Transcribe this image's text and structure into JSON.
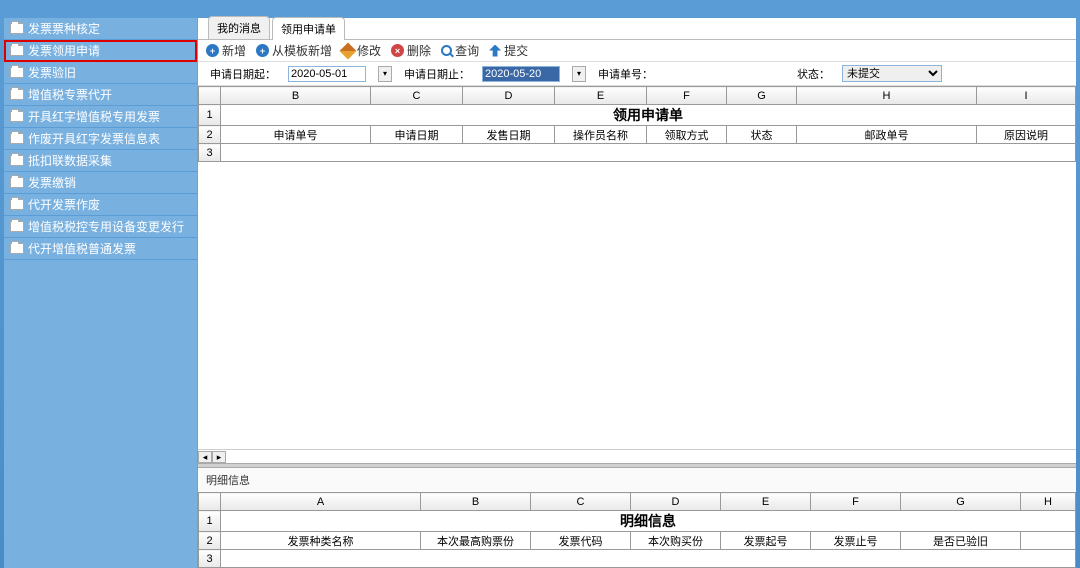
{
  "sidebar": {
    "items": [
      {
        "label": "发票票种核定"
      },
      {
        "label": "发票领用申请"
      },
      {
        "label": "发票验旧"
      },
      {
        "label": "增值税专票代开"
      },
      {
        "label": "开具红字增值税专用发票"
      },
      {
        "label": "作废开具红字发票信息表"
      },
      {
        "label": "抵扣联数据采集"
      },
      {
        "label": "发票缴销"
      },
      {
        "label": "代开发票作废"
      },
      {
        "label": "增值税税控专用设备变更发行"
      },
      {
        "label": "代开增值税普通发票"
      }
    ]
  },
  "tabs": [
    {
      "label": "我的消息"
    },
    {
      "label": "领用申请单"
    }
  ],
  "toolbar": {
    "new": "新增",
    "new_from_tpl": "从模板新增",
    "edit": "修改",
    "delete": "删除",
    "query": "查询",
    "submit": "提交"
  },
  "filters": {
    "date_from_label": "申请日期起：",
    "date_from": "2020-05-01",
    "date_to_label": "申请日期止：",
    "date_to": "2020-05-20",
    "apply_no_label": "申请单号：",
    "status_label": "状态：",
    "status_value": "未提交"
  },
  "main_grid": {
    "col_letters": [
      "B",
      "C",
      "D",
      "E",
      "F",
      "G",
      "H",
      "I"
    ],
    "title": "领用申请单",
    "headers": [
      "申请单号",
      "申请日期",
      "发售日期",
      "操作员名称",
      "领取方式",
      "状态",
      "邮政单号",
      "原因说明"
    ]
  },
  "detail": {
    "section_label": "明细信息",
    "col_letters": [
      "A",
      "B",
      "C",
      "D",
      "E",
      "F",
      "G",
      "H"
    ],
    "title": "明细信息",
    "headers": [
      "发票种类名称",
      "本次最高购票份",
      "发票代码",
      "本次购买份",
      "发票起号",
      "发票止号",
      "是否已验旧",
      ""
    ]
  }
}
